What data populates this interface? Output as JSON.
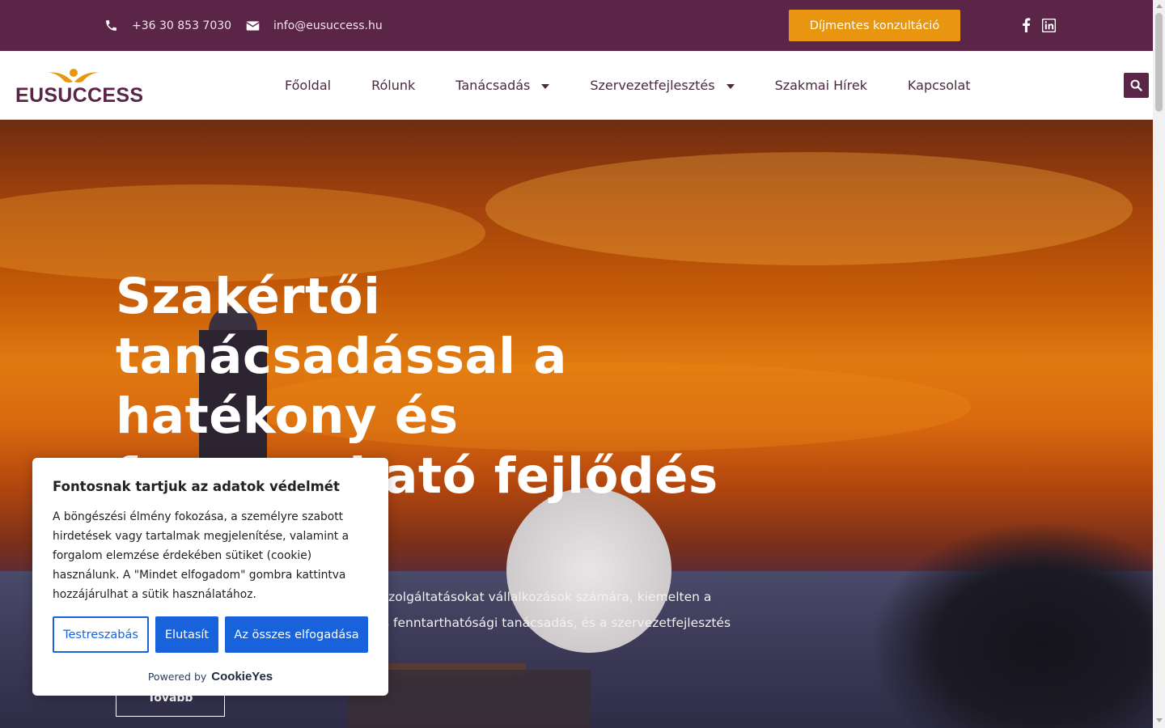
{
  "topbar": {
    "phone": "+36 30 853 7030",
    "email": "info@eusuccess.hu",
    "cta_label": "Díjmentes konzultáció",
    "background_color": "#5b2547",
    "cta_color": "#e8960f",
    "icons": {
      "phone": "phone-icon",
      "email": "envelope-icon",
      "facebook": "facebook-icon",
      "linkedin": "linkedin-icon"
    }
  },
  "header": {
    "logo_text": "EUSUCCESS",
    "nav": [
      {
        "label": "Főoldal",
        "has_dropdown": false
      },
      {
        "label": "Rólunk",
        "has_dropdown": false
      },
      {
        "label": "Tanácsadás",
        "has_dropdown": true
      },
      {
        "label": "Szervezetfejlesztés",
        "has_dropdown": true
      },
      {
        "label": "Szakmai Hírek",
        "has_dropdown": false
      },
      {
        "label": "Kapcsolat",
        "has_dropdown": false
      }
    ],
    "search_icon": "search-icon"
  },
  "hero": {
    "title": "Szakértői tanácsadással a hatékony és fenntartható fejlődés",
    "text_line1": "pi szolgáltatásokat vállalkozások számára, kiemelten a",
    "text_line2": "s fenntarthatósági tanácsadás, és a szervezetfejlesztés",
    "button_label": "Tovább"
  },
  "cookie_banner": {
    "title": "Fontosnak tartjuk az adatok védelmét",
    "body": "A böngészési élmény fokozása, a személyre szabott hirdetések vagy tartalmak megjelenítése, valamint a forgalom elemzése érdekében sütiket (cookie) használunk. A \"Mindet elfogadom\" gombra kattintva hozzájárulhat a sütik használatához.",
    "customize_label": "Testreszabás",
    "reject_label": "Elutasít",
    "accept_label": "Az összes elfogadása",
    "powered_by": "Powered by",
    "brand": "CookieYes",
    "accent_color": "#1863dc"
  }
}
